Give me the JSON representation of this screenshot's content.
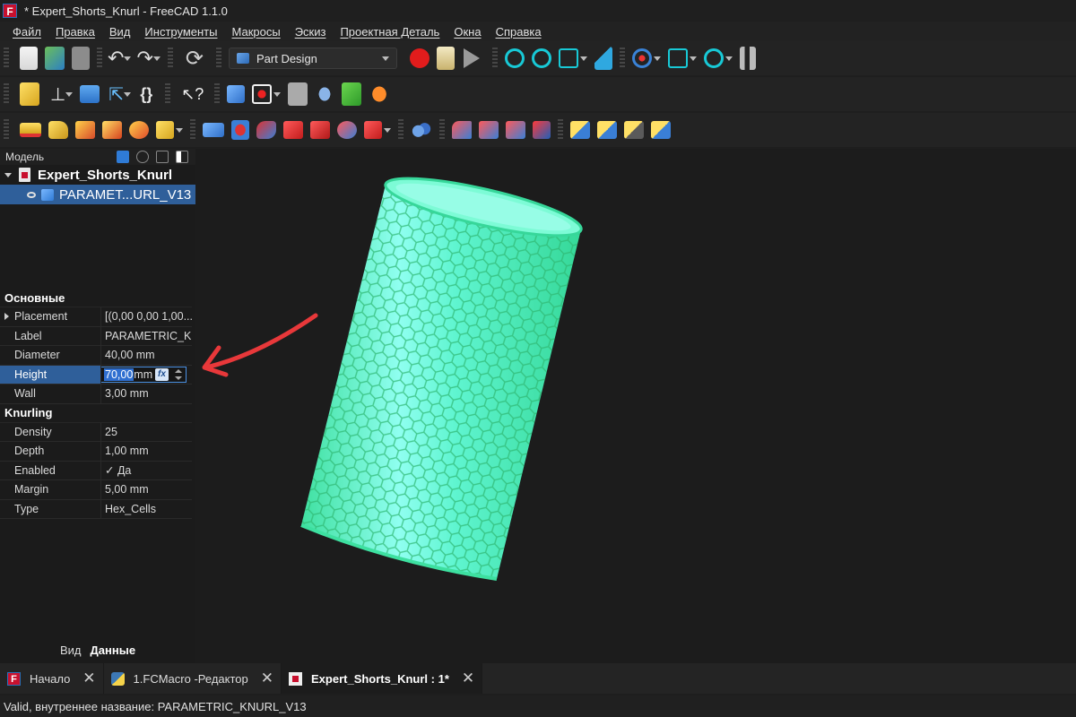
{
  "window": {
    "title": "* Expert_Shorts_Knurl - FreeCAD 1.1.0"
  },
  "menu": [
    "Файл",
    "Правка",
    "Вид",
    "Инструменты",
    "Макросы",
    "Эскиз",
    "Проектная Деталь",
    "Окна",
    "Справка"
  ],
  "toolbar": {
    "workbench": "Part Design"
  },
  "model_panel": {
    "title": "Модель",
    "root": "Expert_Shorts_Knurl",
    "child": "PARAMET...URL_V13"
  },
  "properties": {
    "groups": [
      {
        "name": "Основные",
        "rows": [
          {
            "name": "Placement",
            "value": "[(0,00 0,00 1,00..."
          },
          {
            "name": "Label",
            "value": "PARAMETRIC_K..."
          },
          {
            "name": "Diameter",
            "value": "40,00 mm"
          },
          {
            "name": "Height",
            "value": "70,00",
            "unit": "mm"
          },
          {
            "name": "Wall",
            "value": "3,00 mm"
          }
        ]
      },
      {
        "name": "Knurling",
        "rows": [
          {
            "name": "Density",
            "value": "25"
          },
          {
            "name": "Depth",
            "value": "1,00 mm"
          },
          {
            "name": "Enabled",
            "value": "✓ Да"
          },
          {
            "name": "Margin",
            "value": "5,00 mm"
          },
          {
            "name": "Type",
            "value": "Hex_Cells"
          }
        ]
      }
    ],
    "fx_label": "fx"
  },
  "panel_tabs": [
    "Вид",
    "Данные"
  ],
  "doc_tabs": [
    {
      "label": "Начало",
      "close": "✕"
    },
    {
      "label": "1.FCMacro -Редактор",
      "close": "✕"
    },
    {
      "label": "Expert_Shorts_Knurl : 1*",
      "close": "✕"
    }
  ],
  "status": "Valid, внутреннее название: PARAMETRIC_KNURL_V13",
  "colors": {
    "cylinder": "#4de8a8",
    "cylinder_light": "#9ffff0",
    "arrow": "#e8383a",
    "selection": "#2f5f9a"
  }
}
